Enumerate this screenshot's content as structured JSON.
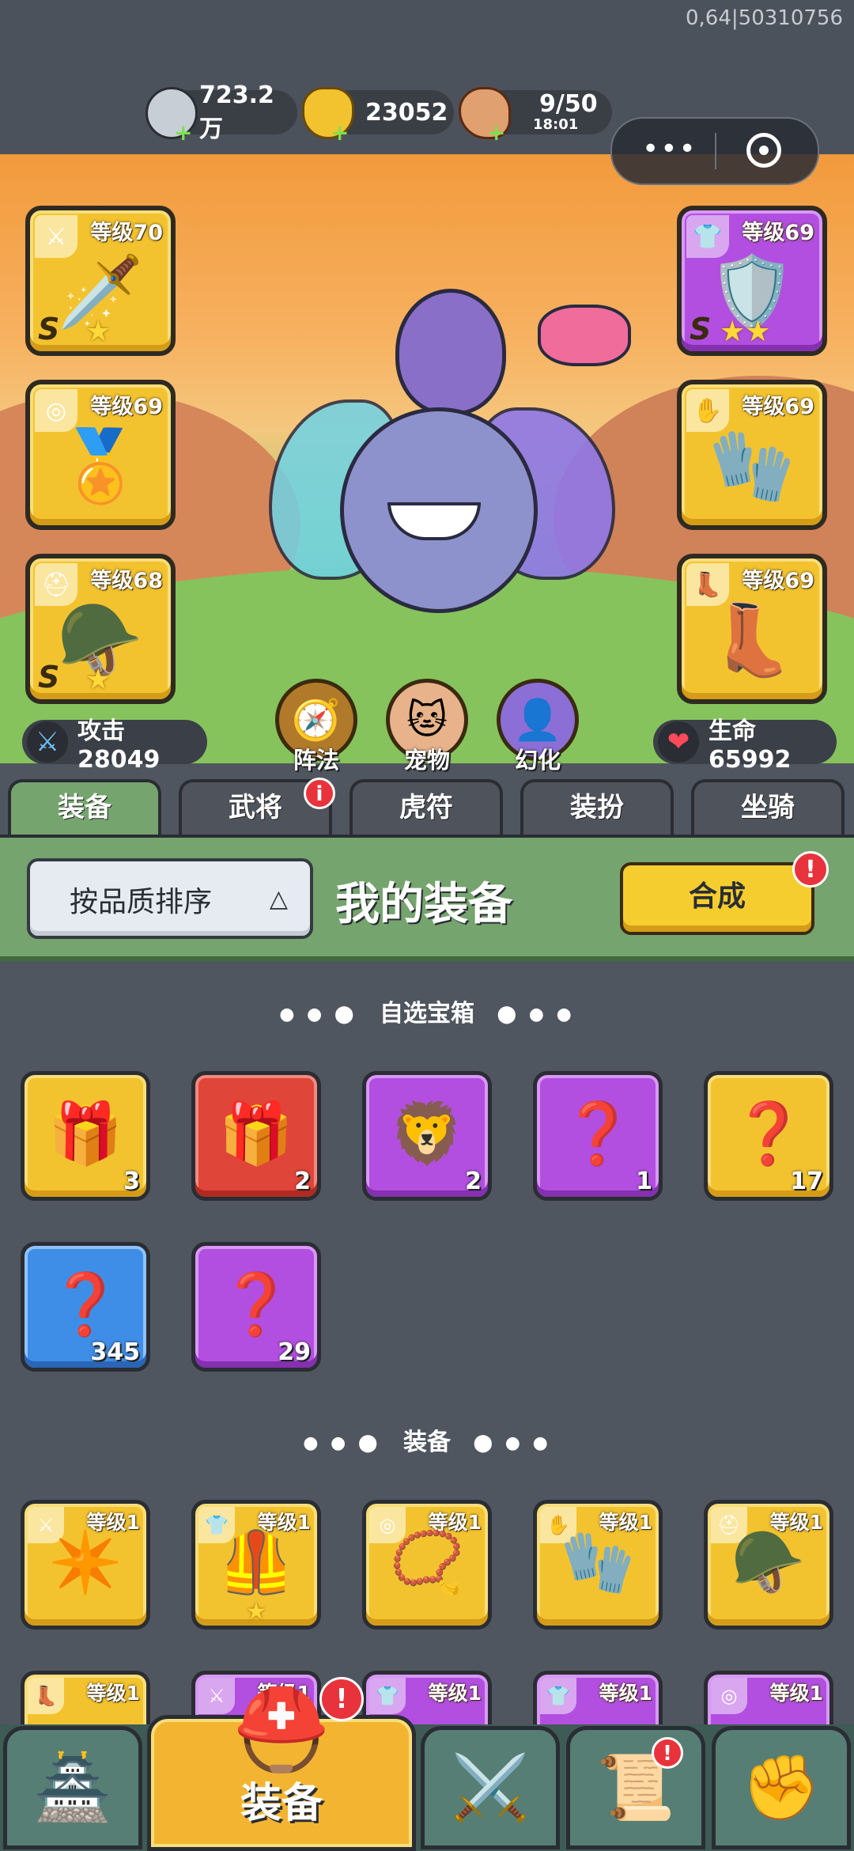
{
  "uid_text": "0,64|50310756",
  "resources": {
    "silver": {
      "value": "723.2万",
      "icon": "silver-coin-icon"
    },
    "gold": {
      "value": "23052",
      "icon": "gold-ingot-icon"
    },
    "stamina": {
      "value": "9/50",
      "timer": "18:01",
      "icon": "meat-icon"
    }
  },
  "capsule": {
    "more": "•••",
    "close_icon": "target-icon"
  },
  "left_slots": [
    {
      "level": "等级70",
      "rank": "S",
      "stars": "★",
      "art": "🗡️",
      "corner": "⚔",
      "color": "gold"
    },
    {
      "level": "等级69",
      "rank": "",
      "stars": "",
      "art": "🏅",
      "corner": "◎",
      "color": "gold"
    },
    {
      "level": "等级68",
      "rank": "S",
      "stars": "★",
      "art": "🪖",
      "corner": "⛑",
      "color": "gold"
    }
  ],
  "right_slots": [
    {
      "level": "等级69",
      "rank": "S",
      "stars": "★★",
      "art": "🛡️",
      "corner": "👕",
      "color": "purple"
    },
    {
      "level": "等级69",
      "rank": "",
      "stars": "",
      "art": "🧤",
      "corner": "✋",
      "color": "gold"
    },
    {
      "level": "等级69",
      "rank": "",
      "stars": "",
      "art": "👢",
      "corner": "👢",
      "color": "gold"
    }
  ],
  "attack": {
    "label": "攻击 28049"
  },
  "life": {
    "label": "生命 65992"
  },
  "round_buttons": [
    {
      "label": "阵法",
      "icon": "formation-icon",
      "art": "🧭"
    },
    {
      "label": "宠物",
      "icon": "pet-cat-icon",
      "art": "🐱"
    },
    {
      "label": "幻化",
      "icon": "illusion-icon",
      "art": "👤"
    }
  ],
  "tabs": [
    "装备",
    "武将",
    "虎符",
    "装扮",
    "坐骑"
  ],
  "tab_badge": "i",
  "sort_button": "按品质排序",
  "panel_title": "我的装备",
  "combine_button": "合成",
  "combine_badge": "!",
  "section_chests": "自选宝箱",
  "section_equip": "装备",
  "chests": [
    {
      "color": "gold",
      "count": "3",
      "art": "🎁"
    },
    {
      "color": "red",
      "count": "2",
      "art": "🎁"
    },
    {
      "color": "purple",
      "count": "2",
      "art": "🦁"
    },
    {
      "color": "purple",
      "count": "1",
      "art": "❓"
    },
    {
      "color": "gold",
      "count": "17",
      "art": "❓"
    },
    {
      "color": "blue",
      "count": "345",
      "art": "❓"
    },
    {
      "color": "purple",
      "count": "29",
      "art": "❓"
    }
  ],
  "equipment_row1": [
    {
      "color": "gold",
      "level": "等级1",
      "corner": "⚔",
      "art": "✴️",
      "star": ""
    },
    {
      "color": "gold",
      "level": "等级1",
      "corner": "👕",
      "art": "🦺",
      "star": "★"
    },
    {
      "color": "gold",
      "level": "等级1",
      "corner": "◎",
      "art": "📿",
      "star": ""
    },
    {
      "color": "gold",
      "level": "等级1",
      "corner": "✋",
      "art": "🧤",
      "star": ""
    },
    {
      "color": "gold",
      "level": "等级1",
      "corner": "⛑",
      "art": "🪖",
      "star": ""
    }
  ],
  "equipment_row2": [
    {
      "color": "gold",
      "level": "等级1",
      "corner": "👢"
    },
    {
      "color": "purple",
      "level": "等级1",
      "corner": "⚔"
    },
    {
      "color": "purple",
      "level": "等级1",
      "corner": "👕"
    },
    {
      "color": "purple",
      "level": "等级1",
      "corner": "👕"
    },
    {
      "color": "purple",
      "level": "等级1",
      "corner": "◎"
    }
  ],
  "bottom_nav": [
    {
      "label": "",
      "icon": "palace-gate-icon",
      "art": "🏯"
    },
    {
      "label": "装备",
      "icon": "helmet-icon",
      "art": "⛑️",
      "badge": "!"
    },
    {
      "label": "",
      "icon": "crossed-swords-icon",
      "art": "⚔️"
    },
    {
      "label": "",
      "icon": "scroll-stars-icon",
      "art": "📜",
      "badge": "!"
    },
    {
      "label": "",
      "icon": "fist-upgrade-icon",
      "art": "✊"
    }
  ]
}
